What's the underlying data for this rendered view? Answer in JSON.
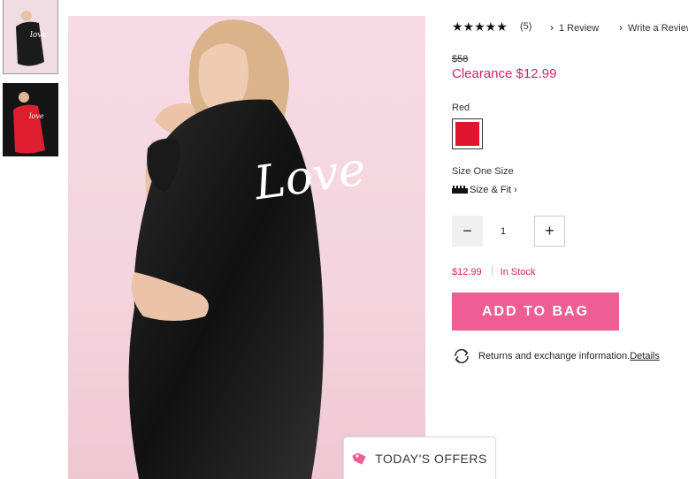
{
  "product": {
    "rating": {
      "stars": "★★★★★",
      "count": "(5)",
      "reviews_link": "1 Review",
      "write_link": "Write a Review"
    },
    "price": {
      "original": "$58",
      "clearance": "Clearance $12.99"
    },
    "color": {
      "label": "Red",
      "swatch_color": "#e01530"
    },
    "size": {
      "label": "Size One Size",
      "fit_link": "Size & Fit"
    },
    "quantity": {
      "value": "1"
    },
    "stock": {
      "price": "$12.99",
      "status": "In Stock"
    },
    "add_to_bag": "ADD TO BAG",
    "returns": {
      "text": "Returns and exchange information.",
      "link": "Details"
    },
    "image_text": "Love"
  },
  "offers_tab": "TODAY'S OFFERS",
  "colors": {
    "accent_pink": "#ee5d94",
    "price_red": "#d0265e"
  }
}
